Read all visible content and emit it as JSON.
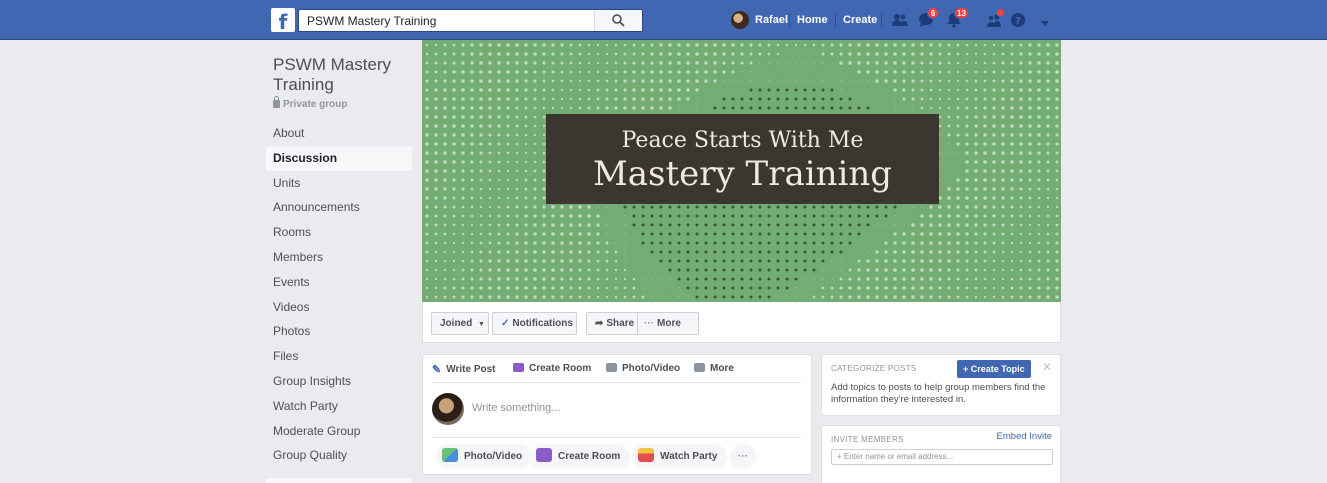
{
  "topbar": {
    "search_value": "PSWM Mastery Training",
    "user_name": "Rafael",
    "home_label": "Home",
    "create_label": "Create",
    "messages_badge": "6",
    "notifications_badge": "13"
  },
  "group": {
    "title": "PSWM Mastery Training",
    "privacy": "Private group"
  },
  "left_nav": {
    "items": [
      {
        "label": "About"
      },
      {
        "label": "Discussion"
      },
      {
        "label": "Units"
      },
      {
        "label": "Announcements"
      },
      {
        "label": "Rooms"
      },
      {
        "label": "Members"
      },
      {
        "label": "Events"
      },
      {
        "label": "Videos"
      },
      {
        "label": "Photos"
      },
      {
        "label": "Files"
      },
      {
        "label": "Group Insights"
      },
      {
        "label": "Watch Party"
      },
      {
        "label": "Moderate Group"
      },
      {
        "label": "Group Quality"
      }
    ],
    "active": "Discussion"
  },
  "cover": {
    "line1": "Peace Starts With Me",
    "line2": "Mastery Training"
  },
  "actions": {
    "joined": "Joined",
    "notifications": "Notifications",
    "share": "Share",
    "more": "More"
  },
  "composer": {
    "tab_write_post": "Write Post",
    "tab_create_room": "Create Room",
    "tab_photo_video": "Photo/Video",
    "tab_more": "More",
    "placeholder": "Write something...",
    "pill_photo_video": "Photo/Video",
    "pill_create_room": "Create Room",
    "pill_watch_party": "Watch Party",
    "pill_more": "···"
  },
  "categorize": {
    "title": "CATEGORIZE POSTS",
    "button": "+ Create Topic",
    "text": "Add topics to posts to help group members find the information they're interested in."
  },
  "invite": {
    "title": "INVITE MEMBERS",
    "embed_link": "Embed Invite",
    "placeholder": "+ Enter name or email address..."
  },
  "colors": {
    "topbar": "#4267b2",
    "cover_green": "#74ad74",
    "cover_box": "#3b3730",
    "badge_red": "#fa3e3e"
  }
}
